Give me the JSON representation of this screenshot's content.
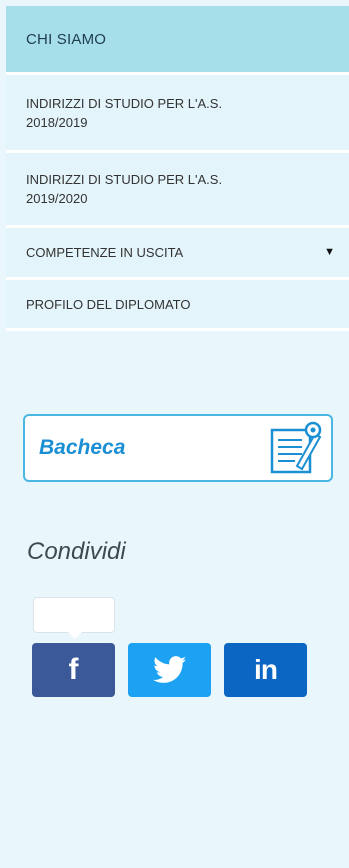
{
  "menu": {
    "header": "CHI SIAMO",
    "items": [
      {
        "label_line1": "INDIRIZZI DI STUDIO PER L'A.S.",
        "label_line2": "2018/2019"
      },
      {
        "label_line1": "INDIRIZZI DI STUDIO PER L'A.S.",
        "label_line2": "2019/2020"
      },
      {
        "label": "COMPETENZE IN USCITA",
        "caret": "▼"
      },
      {
        "label": "PROFILO DEL DIPLOMATO"
      }
    ]
  },
  "bacheca": {
    "label": "Bacheca",
    "icon": "notice-board-icon"
  },
  "share": {
    "title": "Condividi",
    "facebook": {
      "glyph": "f",
      "icon": "facebook-icon",
      "color": "#3b5998"
    },
    "twitter": {
      "icon": "twitter-icon",
      "color": "#1da1f2"
    },
    "linkedin": {
      "glyph": "in",
      "icon": "linkedin-icon",
      "color": "#0a66c2"
    }
  },
  "colors": {
    "header_bg": "#a6dfea",
    "page_bg": "#e9f6fb",
    "accent": "#1b8fd3"
  }
}
